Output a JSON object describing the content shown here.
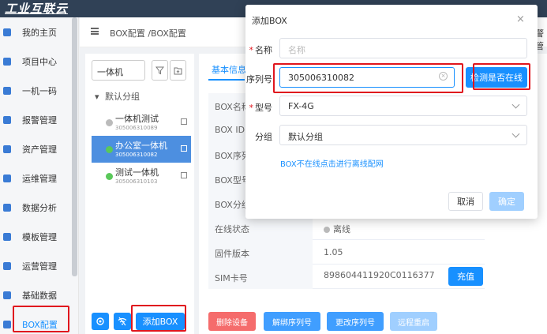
{
  "app": {
    "logo_text": "工业互联云"
  },
  "sidebar": {
    "items": [
      {
        "label": "我的主页",
        "icon": "home-icon"
      },
      {
        "label": "项目中心",
        "icon": "project-icon"
      },
      {
        "label": "一机一码",
        "icon": "qrcode-icon"
      },
      {
        "label": "报警管理",
        "icon": "alarm-icon"
      },
      {
        "label": "资产管理",
        "icon": "asset-icon"
      },
      {
        "label": "运维管理",
        "icon": "maintenance-icon"
      },
      {
        "label": "数据分析",
        "icon": "chart-icon"
      },
      {
        "label": "模板管理",
        "icon": "template-icon"
      },
      {
        "label": "运营管理",
        "icon": "operation-icon"
      },
      {
        "label": "基础数据",
        "icon": "database-icon"
      },
      {
        "label": "BOX配置",
        "icon": "box-icon"
      }
    ],
    "active_label": "BOX配置"
  },
  "header": {
    "breadcrumb": "BOX配置 /BOX配置",
    "right_text": "警管"
  },
  "tree": {
    "search_value": "一体机",
    "group_label": "默认分组",
    "devices": [
      {
        "name": "一体机测试",
        "serial": "305006310089",
        "status": "offline"
      },
      {
        "name": "办公室一体机",
        "serial": "305006310082",
        "status": "online"
      },
      {
        "name": "测试一体机",
        "serial": "305006310103",
        "status": "online"
      }
    ],
    "add_box_label": "添加BOX"
  },
  "detail": {
    "tab_label": "基本信息",
    "rows": [
      {
        "key": "BOX名称",
        "value": ""
      },
      {
        "key": "BOX ID",
        "value": ""
      },
      {
        "key": "BOX序列",
        "value": ""
      },
      {
        "key": "BOX型号",
        "value": ""
      },
      {
        "key": "BOX分组",
        "value": ""
      },
      {
        "key": "在线状态",
        "value": "离线"
      },
      {
        "key": "固件版本",
        "value": "1.05"
      },
      {
        "key": "SIM卡号",
        "value": "898604411920C0116377"
      }
    ],
    "sim_button_label": "充值",
    "actions": {
      "delete": "删除设备",
      "unbind": "解绑序列号",
      "change": "更改序列号",
      "reboot": "远程重启"
    }
  },
  "modal": {
    "title": "添加BOX",
    "close_glyph": "×",
    "name_label": "名称",
    "name_placeholder": "名称",
    "serial_label": "序列号",
    "serial_value": "305006310082",
    "check_button": "检测是否在线",
    "model_label": "型号",
    "model_value": "FX-4G",
    "group_label": "分组",
    "group_value": "默认分组",
    "offline_link": "BOX不在线点击进行离线配网",
    "cancel_label": "取消",
    "ok_label": "确定"
  },
  "colors": {
    "primary": "#1890ff",
    "danger": "#f56c6c",
    "highlight": "#e0161e",
    "logo_bg": "#304156"
  }
}
